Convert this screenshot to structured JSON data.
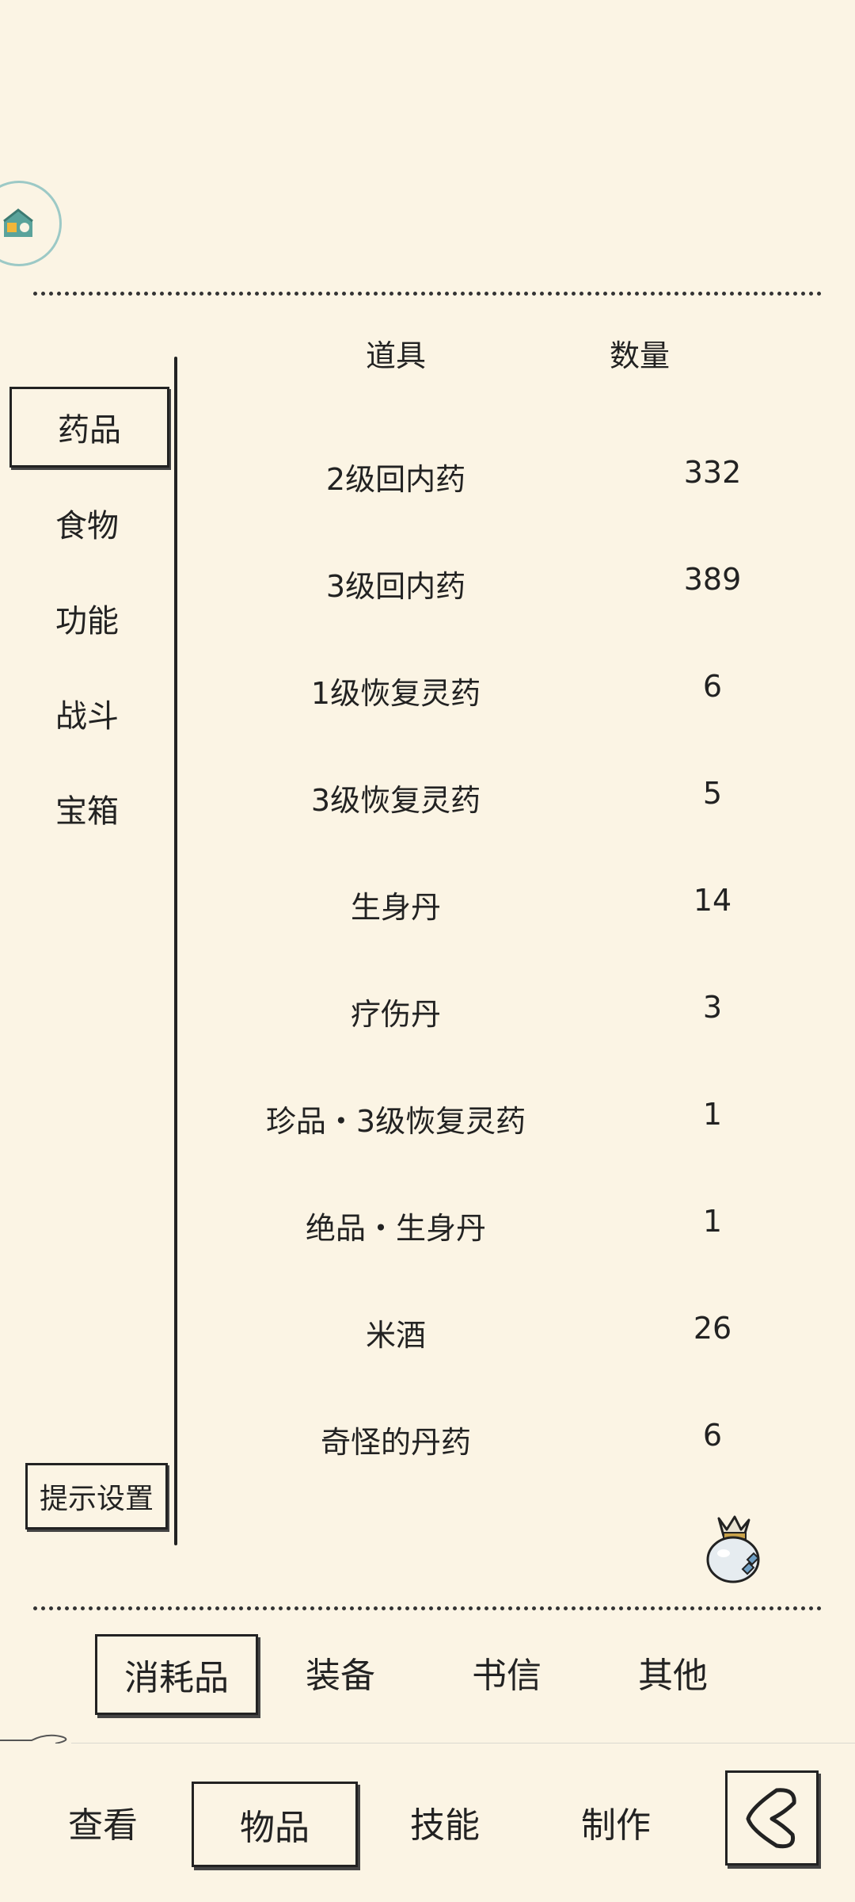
{
  "icons": {
    "avatar": "house-logo-icon",
    "bag": "treasure-bag-icon",
    "back": "back-arrow-icon"
  },
  "header": {
    "item_col": "道具",
    "qty_col": "数量"
  },
  "categories": [
    {
      "label": "药品",
      "active": true
    },
    {
      "label": "食物",
      "active": false
    },
    {
      "label": "功能",
      "active": false
    },
    {
      "label": "战斗",
      "active": false
    },
    {
      "label": "宝箱",
      "active": false
    }
  ],
  "hint_button": "提示设置",
  "items": [
    {
      "name": "2级回内药",
      "qty": "332"
    },
    {
      "name": "3级回内药",
      "qty": "389"
    },
    {
      "name": "1级恢复灵药",
      "qty": "6"
    },
    {
      "name": "3级恢复灵药",
      "qty": "5"
    },
    {
      "name": "生身丹",
      "qty": "14"
    },
    {
      "name": "疗伤丹",
      "qty": "3"
    },
    {
      "name": "珍品・3级恢复灵药",
      "qty": "1"
    },
    {
      "name": "绝品・生身丹",
      "qty": "1"
    },
    {
      "name": "米酒",
      "qty": "26"
    },
    {
      "name": "奇怪的丹药",
      "qty": "6"
    }
  ],
  "tabs": [
    {
      "label": "消耗品",
      "active": true
    },
    {
      "label": "装备",
      "active": false
    },
    {
      "label": "书信",
      "active": false
    },
    {
      "label": "其他",
      "active": false
    }
  ],
  "nav": [
    {
      "label": "查看",
      "active": false
    },
    {
      "label": "物品",
      "active": true
    },
    {
      "label": "技能",
      "active": false
    },
    {
      "label": "制作",
      "active": false
    }
  ]
}
